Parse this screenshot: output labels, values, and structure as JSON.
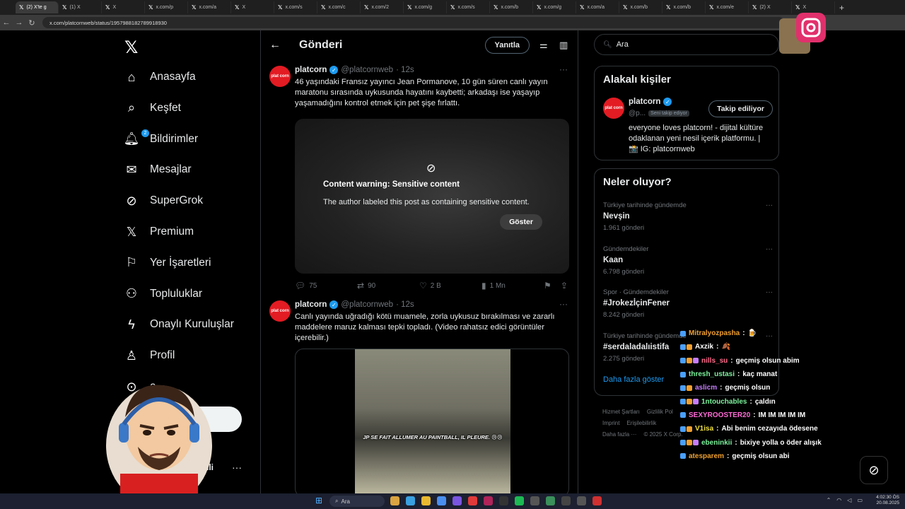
{
  "browser": {
    "tabs": [
      {
        "label": "(2) X'te g",
        "active": true
      },
      {
        "label": "(1) X"
      },
      {
        "label": "X"
      },
      {
        "label": "x.com/p"
      },
      {
        "label": "x.com/a"
      },
      {
        "label": "X"
      },
      {
        "label": "x.com/s"
      },
      {
        "label": "x.com/c"
      },
      {
        "label": "x.com/2"
      },
      {
        "label": "x.com/g"
      },
      {
        "label": "x.com/s"
      },
      {
        "label": "x.com/b"
      },
      {
        "label": "x.com/g"
      },
      {
        "label": "x.com/a"
      },
      {
        "label": "x.com/b"
      },
      {
        "label": "x.com/b"
      },
      {
        "label": "x.com/e"
      },
      {
        "label": "(2) X"
      },
      {
        "label": "X"
      }
    ],
    "url": "x.com/platcornweb/status/1957988182789918930"
  },
  "nav": {
    "items": [
      {
        "label": "Anasayfa",
        "icon": "home-icon"
      },
      {
        "label": "Keşfet",
        "icon": "search-icon"
      },
      {
        "label": "Bildirimler",
        "icon": "bell-icon",
        "badge": "2"
      },
      {
        "label": "Mesajlar",
        "icon": "mail-icon"
      },
      {
        "label": "SuperGrok",
        "icon": "grok-icon"
      },
      {
        "label": "Premium",
        "icon": "x-logo-icon"
      },
      {
        "label": "Yer İşaretleri",
        "icon": "bookmark-icon"
      },
      {
        "label": "Topluluklar",
        "icon": "communities-icon"
      },
      {
        "label": "Onaylı Kuruluşlar",
        "icon": "bolt-icon"
      },
      {
        "label": "Profil",
        "icon": "person-icon"
      },
      {
        "label": "a",
        "icon": "more-circle-icon"
      }
    ],
    "post_button": "yınla",
    "account_name": "nli"
  },
  "main": {
    "title": "Gönderi",
    "reply_button": "Yanıtla",
    "tweets": [
      {
        "avatar": "plat corn",
        "name": "platcorn",
        "handle": "@platcornweb",
        "time": "· 12s",
        "text": "46 yaşındaki Fransız yayıncı Jean Pormanove, 10 gün süren canlı yayın maratonu sırasında uykusunda hayatını kaybetti; arkadaşı ise yaşayıp yaşamadığını kontrol etmek için pet şişe fırlattı.",
        "warning_title": "Content warning: Sensitive content",
        "warning_desc": "The author labeled this post as containing sensitive content.",
        "show_button": "Göster",
        "replies": "75",
        "reposts": "90",
        "likes": "2 B",
        "views": "1 Mn"
      },
      {
        "avatar": "plat corn",
        "name": "platcorn",
        "handle": "@platcornweb",
        "time": "· 12s",
        "text": "Canlı yayında uğradığı kötü muamele, zorla uykusuz bırakılması ve zararlı maddelere maruz kalması tepki topladı. (Video rahatsız edici görüntüler içerebilir.)",
        "video_caption": "JP SE FAIT ALLUMER AU PAINTBALL, IL PLEURE. 😢😢"
      }
    ]
  },
  "right": {
    "search_placeholder": "Ara",
    "related_title": "Alakalı kişiler",
    "person": {
      "avatar": "plat corn",
      "name": "platcorn",
      "handle": "@p...",
      "follows_you": "Seni takip ediyor",
      "follow_button": "Takip ediliyor",
      "bio": "everyone loves platcorn! - dijital kültüre odaklanan yeni nesil içerik platformu. | 📸 IG: platcornweb"
    },
    "trends_title": "Neler oluyor?",
    "trends": [
      {
        "context": "Türkiye tarihinde gündemde",
        "title": "Nevşin",
        "count": "1.961 gönderi"
      },
      {
        "context": "Gündemdekiler",
        "title": "Kaan",
        "count": "6.798 gönderi"
      },
      {
        "context": "Spor · Gündemdekiler",
        "title": "#JrokezİçinFener",
        "count": "8.242 gönderi"
      },
      {
        "context": "Türkiye tarihinde gündemde",
        "title": "#serdaladalıistifa",
        "count": "2.275 gönderi"
      }
    ],
    "show_more": "Daha fazla göster",
    "footer": [
      "Hizmet Şartları",
      "Gizlilik Pol",
      "Imprint",
      "Erişilebilirlik",
      "Daha fazla ···",
      "© 2025 X Corp."
    ]
  },
  "chat": [
    {
      "user": "Mitralyozpasha",
      "msg": "🍺",
      "color": "#f0a030"
    },
    {
      "user": "Axzik",
      "msg": "🍂",
      "color": "#ffffff"
    },
    {
      "user": "nills_su",
      "msg": "geçmiş olsun abim",
      "color": "#ff6b8a"
    },
    {
      "user": "thresh_ustasi",
      "msg": "kaç manat",
      "color": "#7cf29c"
    },
    {
      "user": "aslicm",
      "msg": "geçmiş olsun",
      "color": "#c77dff"
    },
    {
      "user": "1ntouchables",
      "msg": "çaldın",
      "color": "#7cf29c"
    },
    {
      "user": "SEXYROOSTER20",
      "msg": "IM IM IM IM IM",
      "color": "#ff6bd6"
    },
    {
      "user": "V1isa",
      "msg": "Abi benim cezayıda ödesene",
      "color": "#f0e040"
    },
    {
      "user": "ebeninkii",
      "msg": "bixiye yolla o öder alışık",
      "color": "#7cf29c"
    },
    {
      "user": "atesparem",
      "msg": "geçmiş olsun abi",
      "color": "#f0a030"
    }
  ],
  "taskbar": {
    "search": "Ara",
    "time": "4:02:30 ÖS",
    "date": "20.08.2025"
  }
}
